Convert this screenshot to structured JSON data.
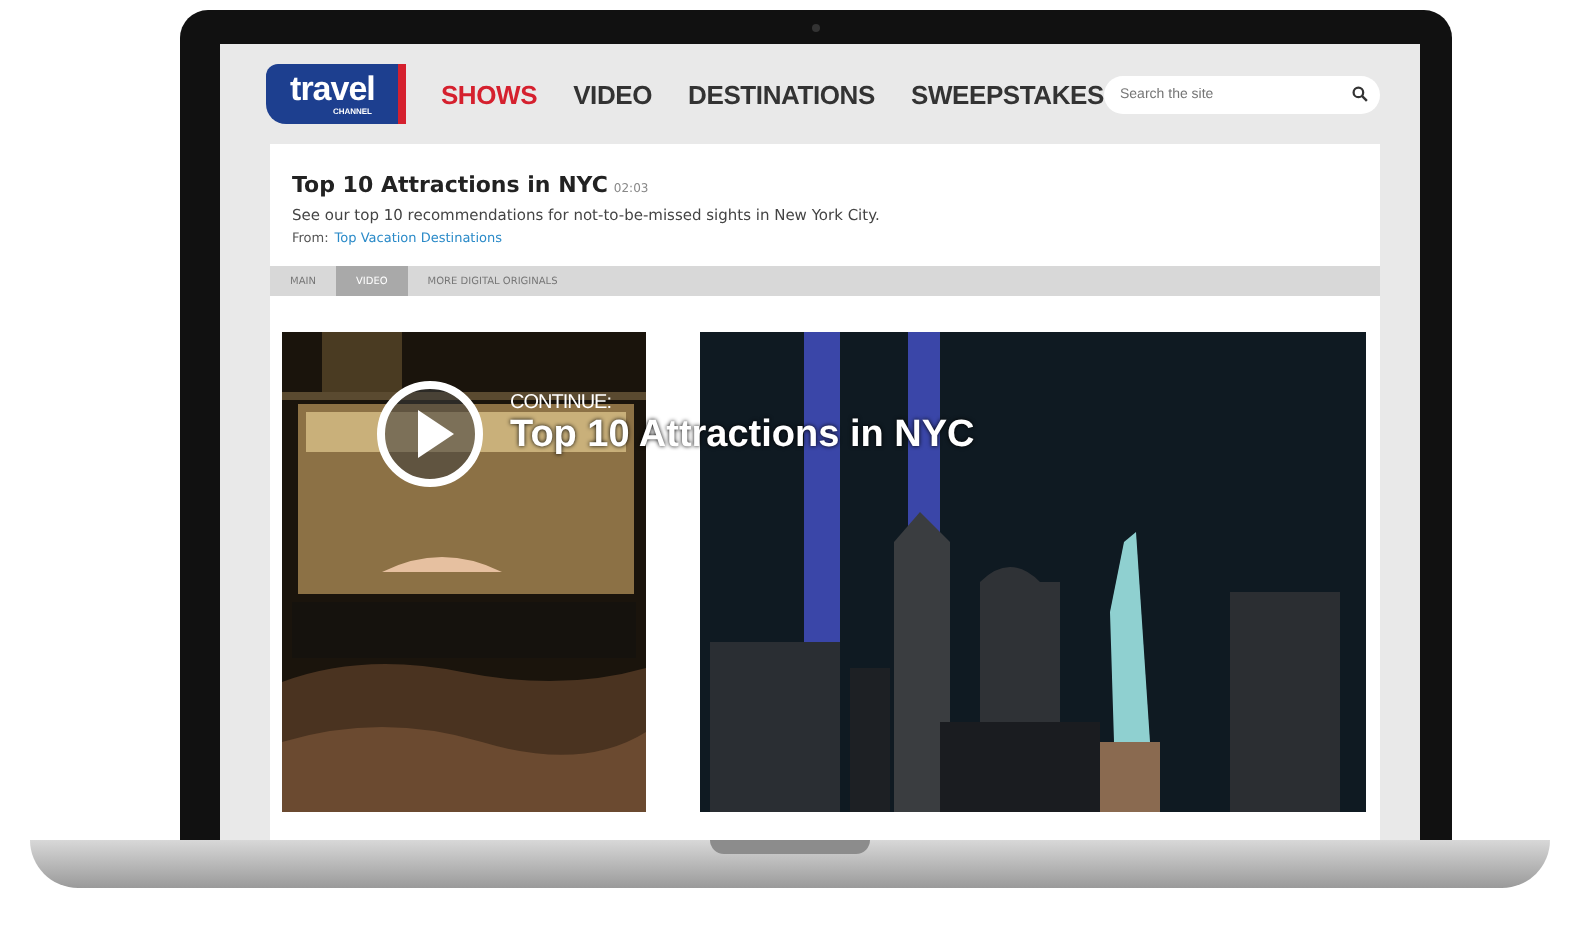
{
  "logo": {
    "word": "travel",
    "sub": "CHANNEL"
  },
  "nav": [
    {
      "label": "SHOWS",
      "selected": true
    },
    {
      "label": "VIDEO",
      "selected": false
    },
    {
      "label": "DESTINATIONS",
      "selected": false
    },
    {
      "label": "SWEEPSTAKES",
      "selected": false
    }
  ],
  "search": {
    "placeholder": "Search the site"
  },
  "video": {
    "title": "Top 10 Attractions in NYC",
    "duration": "02:03",
    "description": "See our top 10 recommendations for not-to-be-missed sights in New York City.",
    "from_label": "From:",
    "from_link": "Top Vacation Destinations"
  },
  "tabs": [
    {
      "label": "MAIN",
      "selected": false
    },
    {
      "label": "VIDEO",
      "selected": true
    },
    {
      "label": "MORE DIGITAL ORIGINALS",
      "selected": false
    }
  ],
  "player": {
    "overlay_label": "CONTINUE:",
    "overlay_title": "Top 10 Attractions in NYC"
  }
}
